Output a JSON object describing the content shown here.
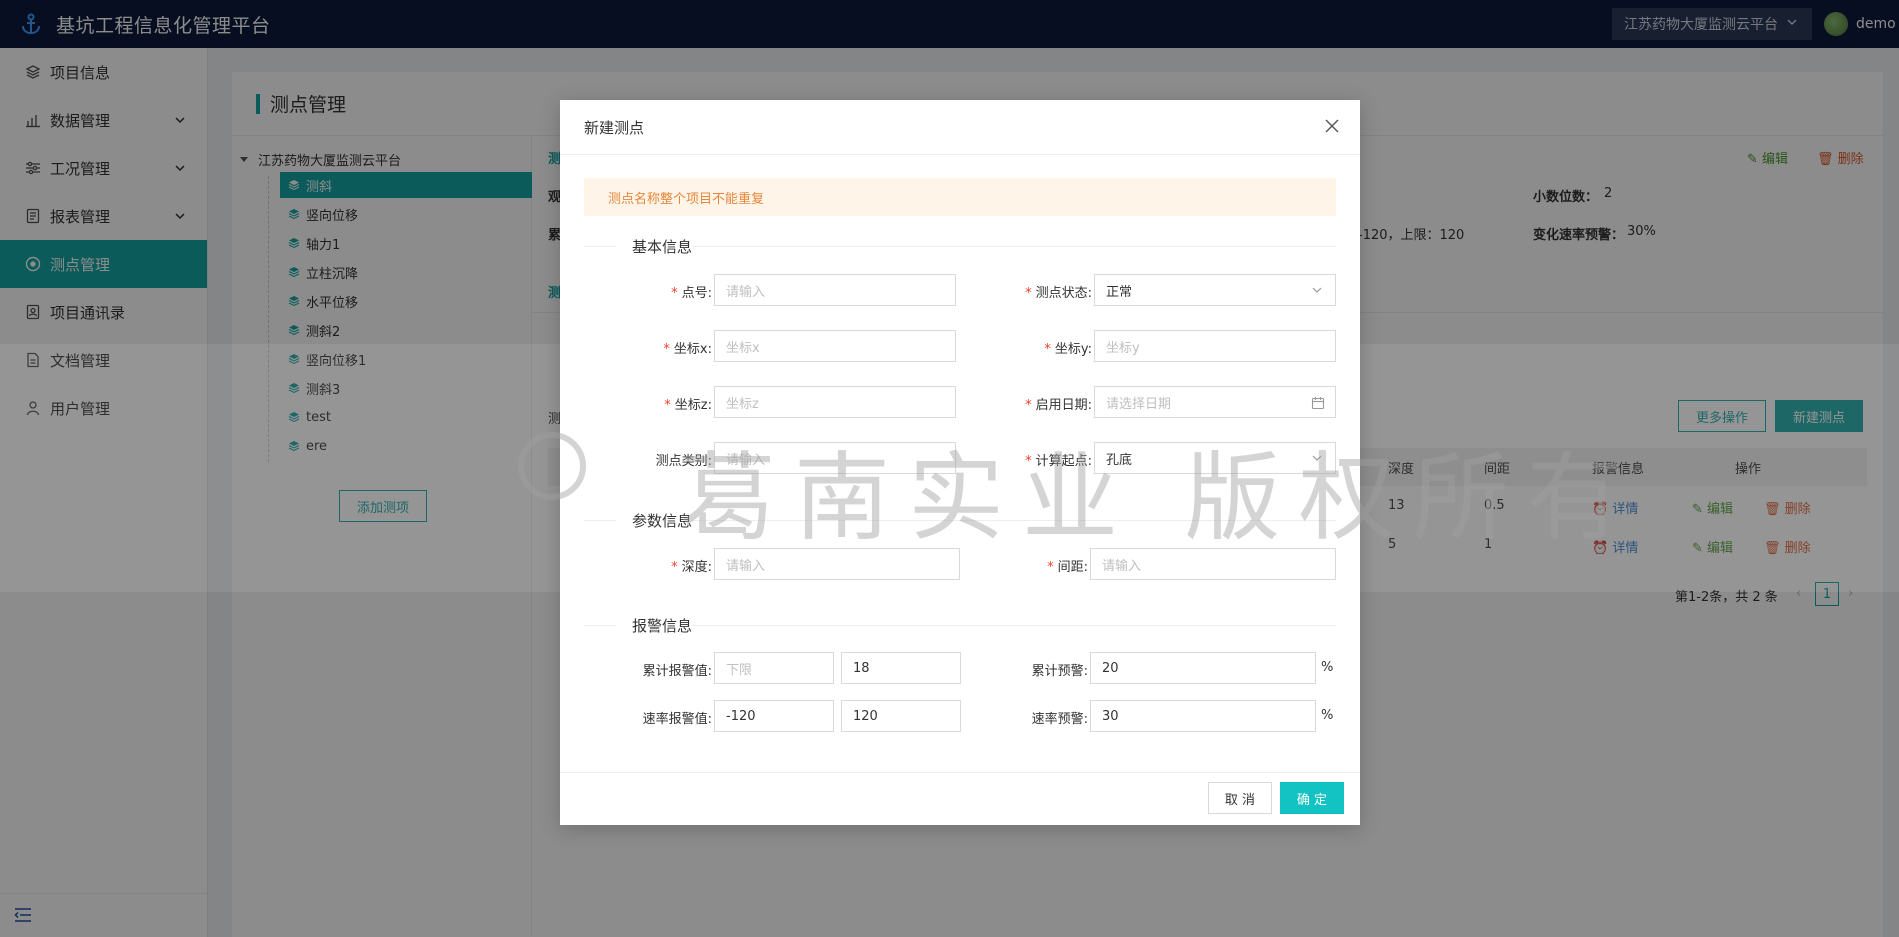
{
  "app": {
    "title": "基坑工程信息化管理平台",
    "project": "江苏药物大厦监测云平台",
    "user": "demo"
  },
  "sidebar": {
    "items": [
      {
        "label": "项目信息",
        "icon": "layers-icon"
      },
      {
        "label": "数据管理",
        "icon": "chart-icon",
        "expandable": true
      },
      {
        "label": "工况管理",
        "icon": "sliders-icon",
        "expandable": true
      },
      {
        "label": "报表管理",
        "icon": "report-icon",
        "expandable": true
      },
      {
        "label": "测点管理",
        "icon": "target-icon",
        "active": true
      },
      {
        "label": "项目通讯录",
        "icon": "contacts-icon"
      },
      {
        "label": "文档管理",
        "icon": "document-icon"
      },
      {
        "label": "用户管理",
        "icon": "user-icon"
      }
    ]
  },
  "page": {
    "title": "测点管理"
  },
  "tree": {
    "root": "江苏药物大厦监测云平台",
    "nodes": [
      "测斜",
      "竖向位移",
      "轴力1",
      "立柱沉降",
      "水平位移",
      "测斜2",
      "竖向位移1",
      "测斜3",
      "test",
      "ere"
    ],
    "add_button": "添加测项"
  },
  "background": {
    "frag_ce1": "测",
    "frag_guan": "观",
    "frag_lei": "累",
    "frag_ce2": "测",
    "frag_ce3": "测",
    "edit": "编辑",
    "delete": "删除",
    "decimals_label": "小数位数：",
    "decimals_value": "2",
    "limit_text": "-120，上限：120",
    "rate_label": "变化速率预警：",
    "rate_value": "30%",
    "more_ops": "更多操作",
    "new_point": "新建测点",
    "table_headers": [
      "深度",
      "间距",
      "报警信息",
      "操作"
    ],
    "rows": [
      {
        "depth": "13",
        "spacing": "0.5",
        "detail": "详情",
        "edit": "编辑",
        "delete": "删除"
      },
      {
        "depth": "5",
        "spacing": "1",
        "detail": "详情",
        "edit": "编辑",
        "delete": "删除"
      }
    ],
    "pagination_text": "第1-2条，共 2 条",
    "page_num": "1"
  },
  "modal": {
    "title": "新建测点",
    "alert": "测点名称整个项目不能重复",
    "sections": {
      "basic": "基本信息",
      "params": "参数信息",
      "alarm": "报警信息"
    },
    "fields": {
      "point_no": {
        "label": "点号:",
        "placeholder": "请输入"
      },
      "status": {
        "label": "测点状态:",
        "value": "正常"
      },
      "x": {
        "label": "坐标x:",
        "placeholder": "坐标x"
      },
      "y": {
        "label": "坐标y:",
        "placeholder": "坐标y"
      },
      "z": {
        "label": "坐标z:",
        "placeholder": "坐标z"
      },
      "start_date": {
        "label": "启用日期:",
        "placeholder": "请选择日期"
      },
      "category": {
        "label": "测点类别:",
        "placeholder": "请输入"
      },
      "origin": {
        "label": "计算起点:",
        "value": "孔底"
      },
      "depth": {
        "label": "深度:",
        "placeholder": "请输入"
      },
      "spacing": {
        "label": "间距:",
        "placeholder": "请输入"
      },
      "cum_alarm": {
        "label": "累计报警值:",
        "lower_placeholder": "下限",
        "upper": "18"
      },
      "cum_warn": {
        "label": "累计预警:",
        "value": "20",
        "unit": "%"
      },
      "rate_alarm": {
        "label": "速率报警值:",
        "lower": "-120",
        "upper": "120"
      },
      "rate_warn": {
        "label": "速率预警:",
        "value": "30",
        "unit": "%"
      }
    },
    "cancel": "取 消",
    "ok": "确 定"
  },
  "watermark": "葛南实业 版权所有",
  "colors": {
    "brand": "#15a6a6",
    "topbar": "#0e1a3d",
    "alert_bg": "#fef5e8",
    "alert_text": "#e8863c",
    "ok_button": "#13c2c2"
  }
}
